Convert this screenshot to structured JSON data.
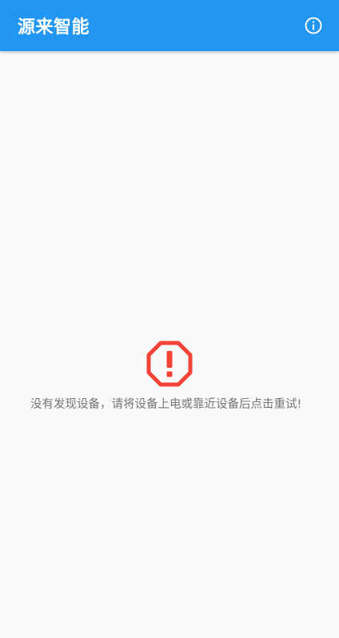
{
  "app_bar": {
    "title": "源来智能",
    "background_color": "#2196f3",
    "info_icon": "info-circle-icon"
  },
  "empty_state": {
    "icon": "warning-octagon-icon",
    "icon_color": "#f44336",
    "message": "没有发现设备，请将设备上电或靠近设备后点击重试!"
  }
}
